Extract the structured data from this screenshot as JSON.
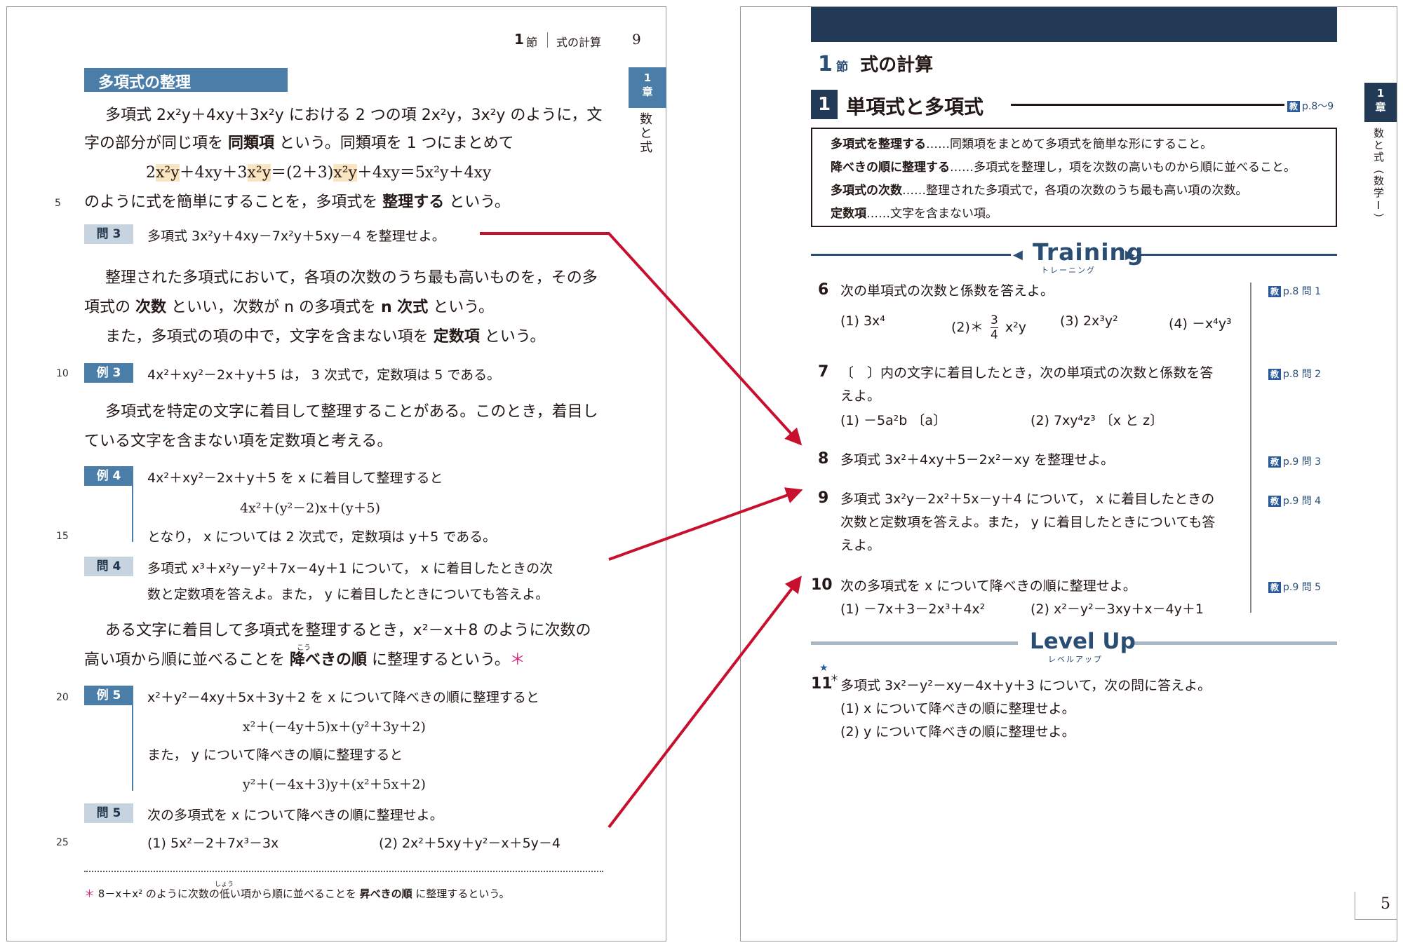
{
  "left": {
    "header": {
      "section_num": "1",
      "section_suffix": "節",
      "section_title": "式の計算",
      "page": "9"
    },
    "side_tab": {
      "chapter_num": "1",
      "chapter_suffix": "章",
      "chapter_title": "数と式"
    },
    "section_title": "多項式の整理",
    "lines": {
      "p1a": "多項式 2x²y＋4xy＋3x²y における 2 つの項 2x²y，3x²y のように，文",
      "p1b_pre": "字の部分が同じ項を ",
      "p1b_bold": "同類項",
      "p1b_post": " という。同類項を 1 つにまとめて",
      "p1c_1": "2",
      "p1c_2": "x²y",
      "p1c_3": "＋4xy＋3",
      "p1c_4": "x²y",
      "p1c_5": "＝(2＋3)",
      "p1c_6": "x²y",
      "p1c_7": "＋4xy＝5x²y＋4xy",
      "p1d_pre": "のように式を簡単にすることを，多項式を ",
      "p1d_bold": "整理する",
      "p1d_post": " という。",
      "q3_label": "問 3",
      "q3_text": "多項式 3x²y＋4xy－7x²y＋5xy－4 を整理せよ。",
      "p2a": "整理された多項式において，各項の次数のうち最も高いものを，その多",
      "p2b_1": "項式の ",
      "p2b_bold1": "次数",
      "p2b_2": " といい，次数が n の多項式を ",
      "p2b_bold2": "n 次式",
      "p2b_3": " という。",
      "p2c_pre": "また，多項式の項の中で，文字を含まない項を ",
      "p2c_bold": "定数項",
      "p2c_post": " という。",
      "ex3_label": "例 3",
      "ex3_text": "4x²＋xy²－2x＋y＋5 は， 3 次式で，定数項は 5 である。",
      "p3a": "多項式を特定の文字に着目して整理することがある。このとき，着目し",
      "p3b": "ている文字を含まない項を定数項と考える。",
      "ex4_label": "例 4",
      "ex4_a": "4x²＋xy²－2x＋y＋5 を x に着目して整理すると",
      "ex4_b": "4x²＋(y²－2)x＋(y＋5)",
      "ex4_c": "となり， x については 2 次式で，定数項は y＋5 である。",
      "q4_label": "問 4",
      "q4_a": "多項式 x³＋x²y－y²＋7x－4y＋1 について， x に着目したときの次",
      "q4_b": "数と定数項を答えよ。また， y に着目したときについても答えよ。",
      "p4a": "ある文字に着目して多項式を整理するとき，x²－x＋8 のように次数の",
      "p4b_pre": "高い項から順に並べることを ",
      "p4b_bold": "降べきの順",
      "p4b_post": " に整理するという。",
      "p4b_ruby": "こう",
      "p4b_star": "＊",
      "ex5_label": "例 5",
      "ex5_a": "x²＋y²－4xy＋5x＋3y＋2 を x について降べきの順に整理すると",
      "ex5_b": "x²＋(－4y＋5)x＋(y²＋3y＋2)",
      "ex5_c": "また， y について降べきの順に整理すると",
      "ex5_d": "y²＋(－4x＋3)y＋(x²＋5x＋2)",
      "q5_label": "問 5",
      "q5_text": "次の多項式を x について降べきの順に整理せよ。",
      "q5_1": "(1)  5x²－2＋7x³－3x",
      "q5_2": "(2)  2x²＋5xy＋y²－x＋5y－4",
      "foot_star": "＊",
      "foot_pre": " 8－x＋x² のように次数の低い項から順に並べることを ",
      "foot_bold": "昇べきの順",
      "foot_post": " に整理するという。",
      "foot_ruby": "しょう"
    },
    "line_numbers": [
      "5",
      "10",
      "15",
      "20",
      "25"
    ]
  },
  "right": {
    "section": {
      "num": "1",
      "suffix": "節",
      "title": "式の計算"
    },
    "subsection": {
      "num": "1",
      "title": "単項式と多項式",
      "ref_kyo": "教",
      "ref": "p.8〜9"
    },
    "definitions": [
      {
        "term": "多項式を整理する",
        "desc": "……同類項をまとめて多項式を簡単な形にすること。"
      },
      {
        "term": "降べきの順に整理する",
        "desc": "……多項式を整理し，項を次数の高いものから順に並べること。"
      },
      {
        "term": "多項式の次数",
        "desc": "……整理された多項式で，各項の次数のうち最も高い項の次数。"
      },
      {
        "term": "定数項",
        "desc": "……文字を含まない項。"
      }
    ],
    "training": {
      "title": "Training",
      "sub": "トレーニング"
    },
    "questions": {
      "q6": {
        "num": "6",
        "text": "次の単項式の次数と係数を答えよ。",
        "ref": "p.8 問 1",
        "opt1": "(1)  3x⁴",
        "opt2_pre": "(2)＊",
        "opt2_num": "3",
        "opt2_den": "4",
        "opt2_post": "x²y",
        "opt3": "(3)  2x³y²",
        "opt4": "(4)  －x⁴y³"
      },
      "q7": {
        "num": "7",
        "text_a": "〔　〕内の文字に着目したとき，次の単項式の次数と係数を答",
        "text_b": "えよ。",
        "ref": "p.8 問 2",
        "opt1": "(1)  －5a²b 〔a〕",
        "opt2": "(2)  7xy⁴z³ 〔x と z〕"
      },
      "q8": {
        "num": "8",
        "text": "多項式 3x²＋4xy＋5－2x²－xy を整理せよ。",
        "ref": "p.9 問 3"
      },
      "q9": {
        "num": "9",
        "text_a": "多項式 3x²y－2x²＋5x－y＋4 について， x に着目したときの",
        "text_b": "次数と定数項を答えよ。また， y に着目したときについても答",
        "text_c": "えよ。",
        "ref": "p.9 問 4"
      },
      "q10": {
        "num": "10",
        "text": "次の多項式を x について降べきの順に整理せよ。",
        "ref": "p.9 問 5",
        "opt1": "(1)  －7x＋3－2x³＋4x²",
        "opt2": "(2)  x²－y²－3xy＋x－4y＋1"
      }
    },
    "levelup": {
      "title": "Level Up",
      "sub": "レベルアップ"
    },
    "q11": {
      "num": "11",
      "star": "★",
      "mark": "＊",
      "text": "多項式 3x²－y²－xy－4x＋y＋3 について，次の問に答えよ。",
      "opt1": "(1)  x について降べきの順に整理せよ。",
      "opt2": "(2)  y について降べきの順に整理せよ。"
    },
    "side_tab": {
      "chapter_num": "1",
      "chapter_suffix": "章",
      "chapter_title": "数と式（数学Ⅰ）"
    },
    "page": "5",
    "kyo": "教"
  },
  "colors": {
    "accent": "#4a7ea9",
    "navy": "#223a55",
    "arrow": "#c8102e",
    "highlight": "#fbe5c0"
  }
}
